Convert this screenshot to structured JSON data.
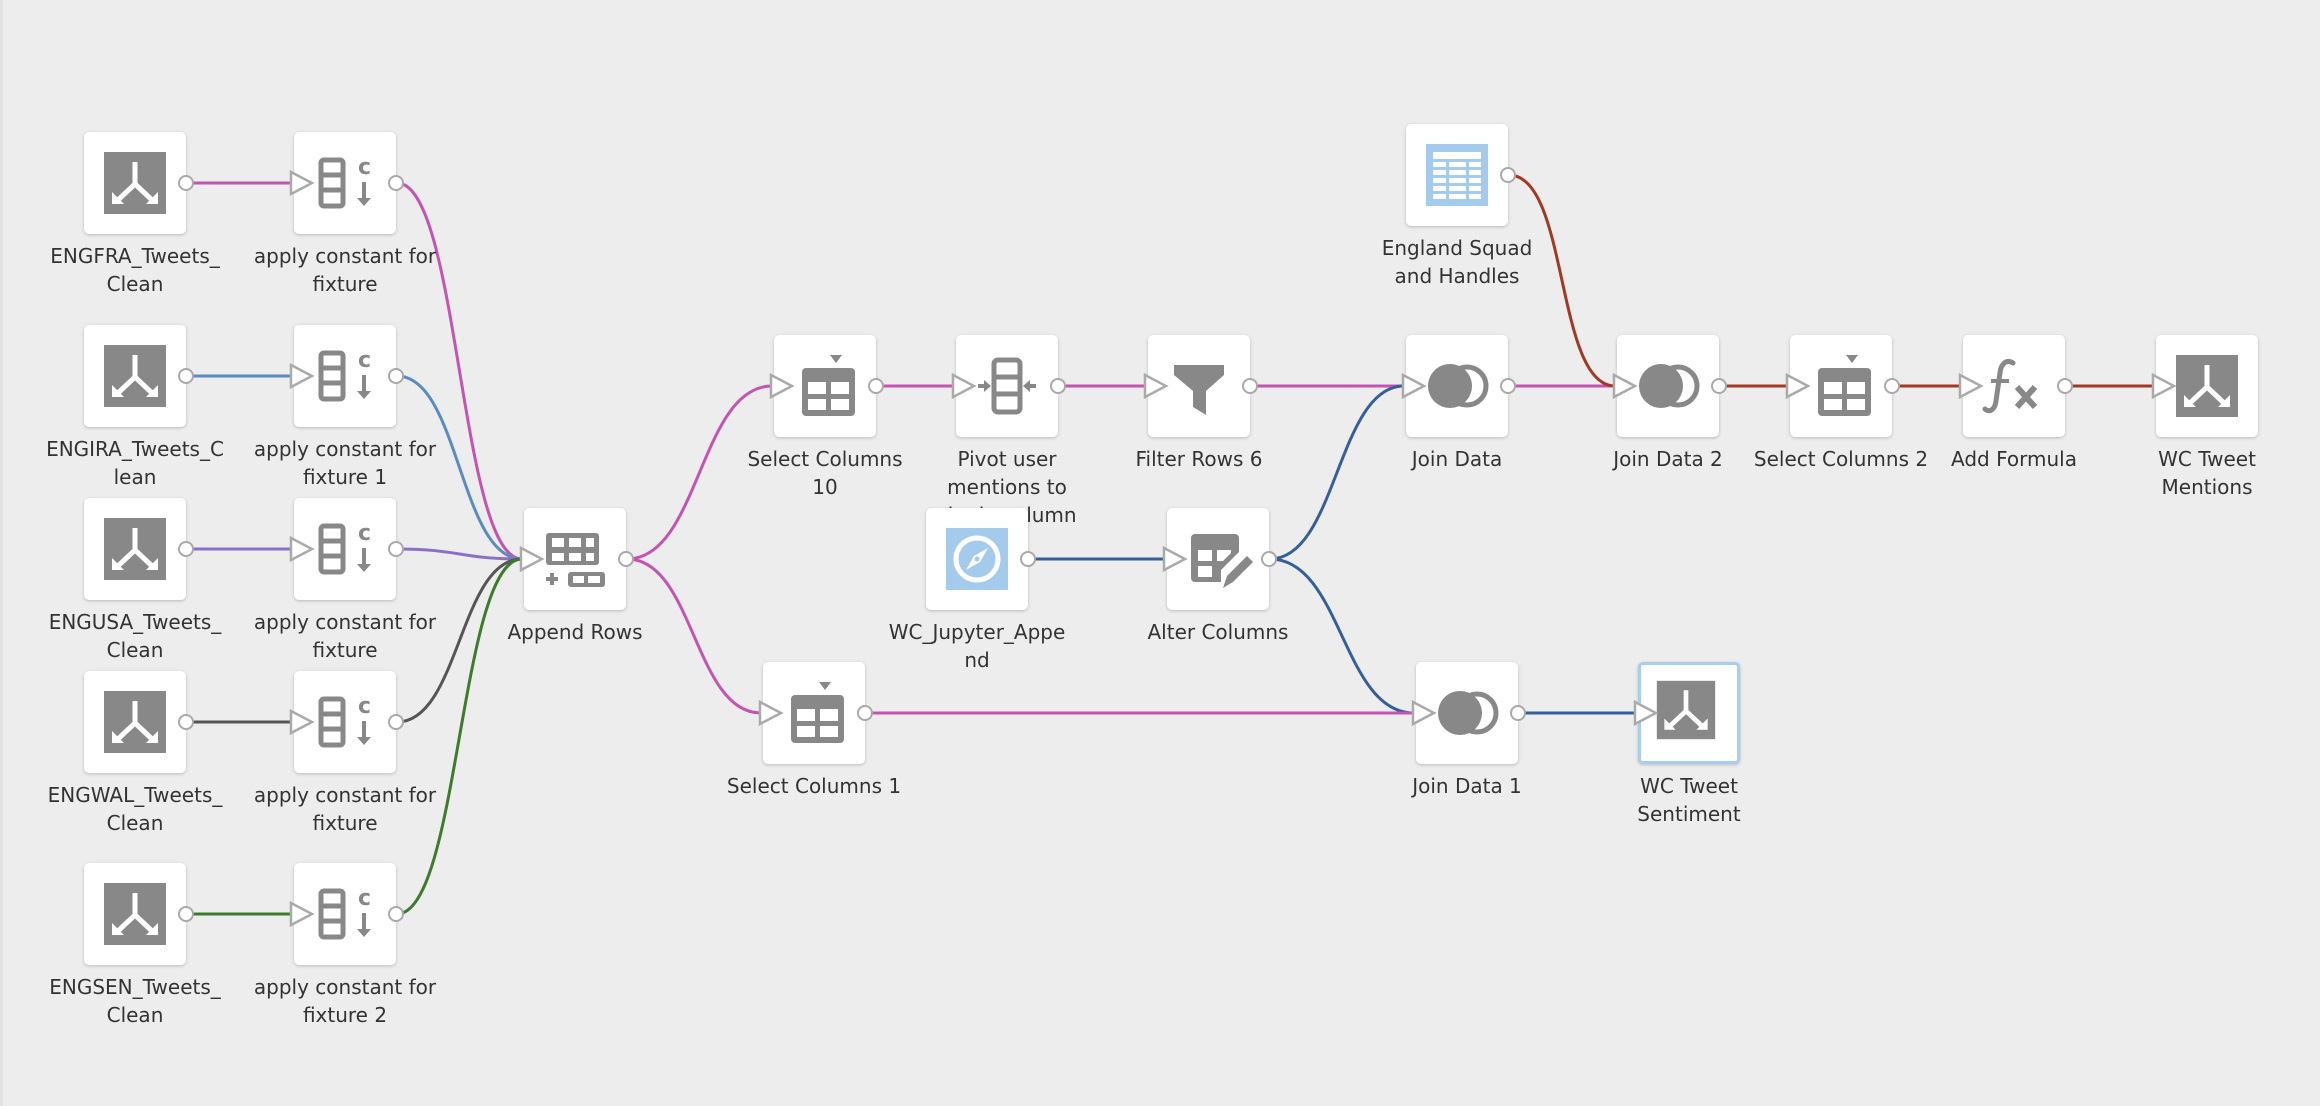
{
  "app": {
    "view": "Data Flow Canvas"
  },
  "edge_colors": {
    "pink": "#c355b0",
    "blue": "#5b8cc0",
    "purple": "#8b6fc6",
    "gray": "#555555",
    "green": "#3f7b2d",
    "navy": "#365f99",
    "brown": "#a13a25"
  },
  "nodes": [
    {
      "id": "engfra",
      "label": "ENGFRA_Tweets_\nClean",
      "type": "dataset-output",
      "icon": "split-arrows-icon"
    },
    {
      "id": "engira",
      "label": "ENGIRA_Tweets_C\nlean",
      "type": "dataset-output",
      "icon": "split-arrows-icon"
    },
    {
      "id": "engusa",
      "label": "ENGUSA_Tweets_\nClean",
      "type": "dataset-output",
      "icon": "split-arrows-icon"
    },
    {
      "id": "engwal",
      "label": "ENGWAL_Tweets_\nClean",
      "type": "dataset-output",
      "icon": "split-arrows-icon"
    },
    {
      "id": "engsen",
      "label": "ENGSEN_Tweets_\nClean",
      "type": "dataset-output",
      "icon": "split-arrows-icon"
    },
    {
      "id": "const1",
      "label": "apply constant for\nfixture",
      "type": "constant",
      "icon": "constant-column-icon"
    },
    {
      "id": "const2",
      "label": "apply constant for\nfixture 1",
      "type": "constant",
      "icon": "constant-column-icon"
    },
    {
      "id": "const3",
      "label": "apply constant for\nfixture",
      "type": "constant",
      "icon": "constant-column-icon"
    },
    {
      "id": "const4",
      "label": "apply constant for\nfixture",
      "type": "constant",
      "icon": "constant-column-icon"
    },
    {
      "id": "const5",
      "label": "apply constant for\nfixture 2",
      "type": "constant",
      "icon": "constant-column-icon"
    },
    {
      "id": "append",
      "label": "Append Rows",
      "type": "append",
      "icon": "append-rows-icon"
    },
    {
      "id": "sel10",
      "label": "Select Columns\n10",
      "type": "select",
      "icon": "select-columns-icon"
    },
    {
      "id": "pivot",
      "label": "Pivot user\nmentions to\nsingle column",
      "type": "pivot",
      "icon": "pivot-icon"
    },
    {
      "id": "filter",
      "label": "Filter Rows 6",
      "type": "filter",
      "icon": "filter-icon"
    },
    {
      "id": "squad",
      "label": "England Squad\nand Handles",
      "type": "dataset-input",
      "icon": "spreadsheet-icon"
    },
    {
      "id": "join",
      "label": "Join Data",
      "type": "join",
      "icon": "join-icon"
    },
    {
      "id": "join2",
      "label": "Join Data 2",
      "type": "join",
      "icon": "join-icon"
    },
    {
      "id": "sel2",
      "label": "Select Columns 2",
      "type": "select",
      "icon": "select-columns-icon"
    },
    {
      "id": "formula",
      "label": "Add Formula",
      "type": "formula",
      "icon": "formula-icon"
    },
    {
      "id": "mentions",
      "label": "WC Tweet\nMentions",
      "type": "dataset-output",
      "icon": "split-arrows-icon"
    },
    {
      "id": "jupyter",
      "label": "WC_Jupyter_Appe\nnd",
      "type": "dataset-input",
      "icon": "compass-icon"
    },
    {
      "id": "alter",
      "label": "Alter Columns",
      "type": "alter",
      "icon": "alter-columns-icon"
    },
    {
      "id": "sel1",
      "label": "Select Columns 1",
      "type": "select",
      "icon": "select-columns-icon"
    },
    {
      "id": "join1",
      "label": "Join Data 1",
      "type": "join",
      "icon": "join-icon"
    },
    {
      "id": "sentiment",
      "label": "WC Tweet\nSentiment",
      "type": "dataset-output",
      "icon": "split-arrows-icon",
      "selected": true
    }
  ],
  "edges": [
    {
      "from": "engfra",
      "to": "const1",
      "color": "pink"
    },
    {
      "from": "engira",
      "to": "const2",
      "color": "blue"
    },
    {
      "from": "engusa",
      "to": "const3",
      "color": "purple"
    },
    {
      "from": "engwal",
      "to": "const4",
      "color": "gray"
    },
    {
      "from": "engsen",
      "to": "const5",
      "color": "green"
    },
    {
      "from": "const1",
      "to": "append",
      "color": "pink"
    },
    {
      "from": "const2",
      "to": "append",
      "color": "blue"
    },
    {
      "from": "const3",
      "to": "append",
      "color": "purple"
    },
    {
      "from": "const4",
      "to": "append",
      "color": "gray"
    },
    {
      "from": "const5",
      "to": "append",
      "color": "green"
    },
    {
      "from": "append",
      "to": "sel10",
      "color": "pink"
    },
    {
      "from": "append",
      "to": "sel1",
      "color": "pink"
    },
    {
      "from": "sel10",
      "to": "pivot",
      "color": "pink"
    },
    {
      "from": "pivot",
      "to": "filter",
      "color": "pink"
    },
    {
      "from": "filter",
      "to": "join",
      "color": "pink"
    },
    {
      "from": "jupyter",
      "to": "alter",
      "color": "navy"
    },
    {
      "from": "alter",
      "to": "join",
      "color": "navy"
    },
    {
      "from": "alter",
      "to": "join1",
      "color": "navy"
    },
    {
      "from": "join",
      "to": "join2",
      "color": "pink"
    },
    {
      "from": "squad",
      "to": "join2",
      "color": "brown"
    },
    {
      "from": "join2",
      "to": "sel2",
      "color": "brown"
    },
    {
      "from": "sel2",
      "to": "formula",
      "color": "brown"
    },
    {
      "from": "formula",
      "to": "mentions",
      "color": "brown"
    },
    {
      "from": "sel1",
      "to": "join1",
      "color": "pink"
    },
    {
      "from": "join1",
      "to": "sentiment",
      "color": "navy"
    }
  ]
}
